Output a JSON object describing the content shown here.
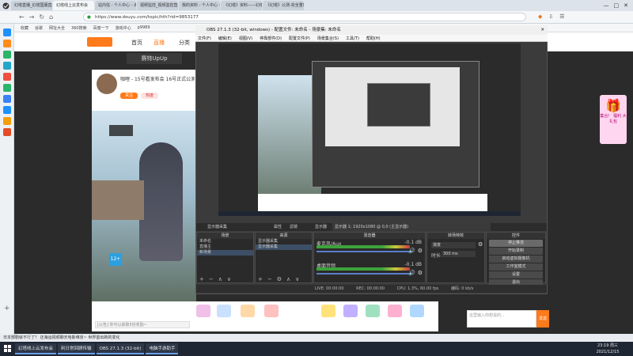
{
  "browser": {
    "tabs": [
      {
        "label": "幻塔直播_幻塔国服直播"
      },
      {
        "label": "幻塔线上云发布会"
      },
      {
        "label": "站内信 - 个人中心 - 头条"
      },
      {
        "label": "视频监控_视频监控直播间"
      },
      {
        "label": "我的资料 - 个人中心 - 头条"
      },
      {
        "label": "《幻塔》资料——幻塔wiki"
      },
      {
        "label": "《幻塔》公测-完全重新制作"
      }
    ],
    "url": "https://www.douyu.com/topic/hth?rid=9853177",
    "bookmarks": [
      "收藏",
      "谷歌",
      "网址大全",
      "360搜索",
      "百度一下",
      "游戏中心",
      "p9989"
    ]
  },
  "site": {
    "nav": [
      "首页",
      "直播",
      "分类"
    ],
    "room_title": "赛特UpUp",
    "streamer_title": "咖哩 - 15号看发布会 16号正式公测！",
    "follow_label": "关注",
    "hot_label": "热度"
  },
  "obs": {
    "window_title": "OBS 27.1.3 (32-bit, windows) - 配置文件: 未命名 - 场景集: 未命名",
    "menu": [
      "文件(F)",
      "编辑(E)",
      "视图(V)",
      "停靠部件(D)",
      "配置文件(P)",
      "场景集合(S)",
      "工具(T)",
      "帮助(H)"
    ],
    "source_bar": {
      "source": "显示器采集",
      "props": "属性",
      "filter": "滤镜",
      "screen_label": "显示器",
      "screen_value": "显示器 1: 1920x1080 @ 0,0 (主显示器)"
    },
    "docks": {
      "scenes": {
        "title": "场景",
        "items": [
          "未命名",
          "直播主",
          "新场景"
        ]
      },
      "sources": {
        "title": "来源",
        "items": [
          "显示器采集",
          "显示器采集"
        ]
      },
      "mixer": {
        "title": "混音器",
        "tracks": [
          {
            "name": "麦克风/Aux",
            "db": "-0.1 dB"
          },
          {
            "name": "桌面音频",
            "db": "-0.1 dB"
          }
        ]
      },
      "transitions": {
        "title": "转场特效",
        "type": "渐变",
        "duration_label": "时长",
        "duration_value": "300 ms"
      },
      "controls": {
        "title": "控件",
        "buttons": [
          "停止推流",
          "开始录制",
          "启动虚拟摄像机",
          "工作室模式",
          "设置",
          "退出"
        ]
      }
    },
    "status": {
      "live": "LIVE: 00:00:00",
      "rec": "REC: 00:00:00",
      "cpu": "CPU: 1.3%, 60.00 fps",
      "kbps": "编码: 0 kb/s"
    }
  },
  "ad": {
    "text": "集合！ 福利 大礼包"
  },
  "chat": {
    "placeholder": "这里输入你想说的...",
    "send_label": "发送"
  },
  "danmu": {
    "placeholder": "[公告] 你可以获取5份奖励~"
  },
  "notice": "日本部剧就不行了？ 还海运视频聊天哈斯维京~ 世界首出新的变化",
  "taskbar": {
    "items": [
      "幻塔线上云发布会",
      "利日常回顾传输",
      "OBS 27.1.3 (32-bit)",
      "电脑手游助手"
    ],
    "time": "23:19 周三",
    "date": "2021/12/15"
  },
  "colors": {
    "accent": "#ff7a1a",
    "obs_bg": "#3b3b3b",
    "taskbar": "#1f2633"
  }
}
